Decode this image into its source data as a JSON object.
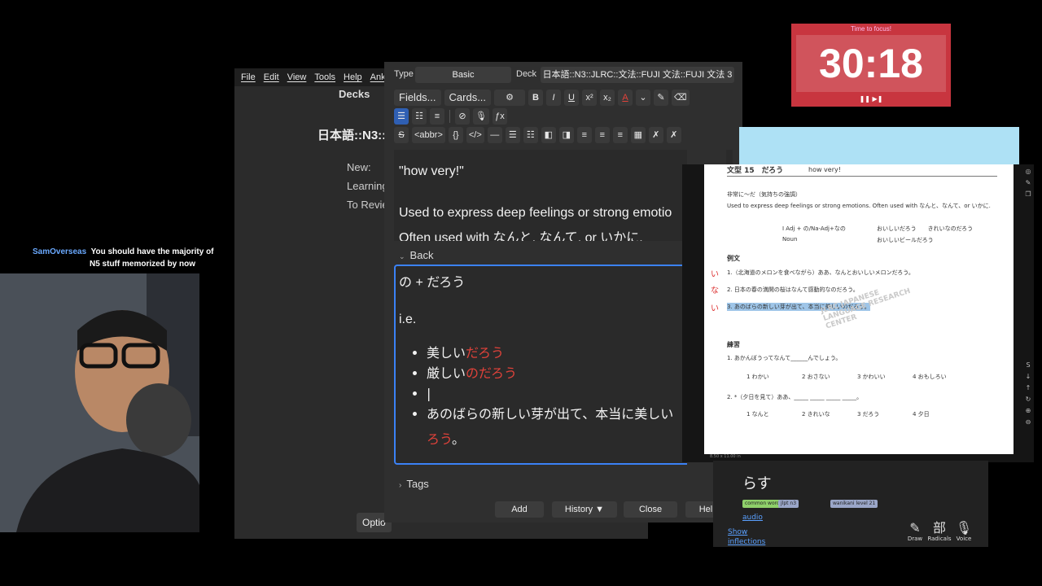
{
  "anki_main": {
    "menu": [
      "File",
      "Edit",
      "View",
      "Tools",
      "Help",
      "Anki"
    ],
    "decks_title": "Decks",
    "deck_name": "日本語::N3::",
    "stats": [
      "New:",
      "Learning",
      "To Revie"
    ],
    "options_label": "Optio"
  },
  "add_dialog": {
    "type_label": "Type",
    "type_value": "Basic",
    "deck_label": "Deck",
    "deck_value": "日本語::N3::JLRC::文法::FUJI 文法::FUJI 文法 3",
    "toolbar1": {
      "fields": "Fields...",
      "cards": "Cards...",
      "gear": "⚙",
      "bold": "B",
      "italic": "I",
      "underline": "U",
      "superscript": "x²",
      "subscript": "x₂",
      "text_color": "A",
      "chevron": "⌄",
      "highlight": "✎",
      "eraser": "⌫"
    },
    "toolbar2": {
      "ul": "☰",
      "ol": "☷",
      "indent": "≡",
      "attach": "⊘",
      "record": "🎙",
      "fx": "ƒx"
    },
    "toolbar3": {
      "strike": "S",
      "abbr": "<abbr>",
      "braces": "{}",
      "code": "</>",
      "hr": "—"
    },
    "front": {
      "line1": "\"how very!\"",
      "line2": "Used to express deep feelings or strong emotio",
      "line3": "Often used with なんと, なんて, or いかに."
    },
    "back_label": "Back",
    "back": {
      "formula": "の + だろう",
      "ie": "i.e.",
      "items": [
        {
          "black": "美しい",
          "red": "だろう"
        },
        {
          "black": "厳しい",
          "red": "のだろう"
        },
        {
          "black": "|",
          "red": ""
        },
        {
          "black": "あのばらの新しい芽が出て、本当に美しい",
          "red": ""
        }
      ],
      "wrap_red": "ろう",
      "wrap_end": "。"
    },
    "tags_label": "Tags",
    "buttons": {
      "add": "Add",
      "history": "History ▼",
      "close": "Close",
      "help": "Help"
    }
  },
  "pdf": {
    "heading": "文型 15　だろう",
    "heading_gloss": "how very!",
    "subtitle": "非常に～だ（気持ちの強調）",
    "desc": "Used to express deep feelings or strong emotions. Often used with なんと、なんて、or いかに.",
    "formula1": "I Adj + の/Na-Adj+なの",
    "formula2": "Noun",
    "ex_right1": "おいしいだろう　　きれいなのだろう",
    "ex_right2": "おいしいビールだろう",
    "reibun": "例文",
    "sentences": [
      "1.（北海道のメロンを食べながら）ああ、なんとおいしいメロンだろう。",
      "2. 日本の春の満開の桜はなんて感動的なのだろう。",
      "3. あのばらの新しい芽が出て、本当に美しいのだろう。"
    ],
    "watermark": "JLRC JAPANESE LANGUAGE RESEARCH CENTER",
    "renshuu": "練習",
    "q1": "1. あかんぼうってなんて______んでしょう。",
    "q1_opts": [
      "1 わかい",
      "2 おさない",
      "3 かわいい",
      "4 おもしろい"
    ],
    "q2": "2. *（夕日を見て）ああ、_____ _____ _____ _____。",
    "q2_opts": [
      "1 なんと",
      "2 きれいな",
      "3 だろう",
      "4 夕日"
    ],
    "page_footer": "8.50 x 11.00 in"
  },
  "dictionary": {
    "word": "らす",
    "tags": [
      "common word",
      "jlpt n3",
      "wanikani level 21"
    ],
    "audio": "audio",
    "show": "Show",
    "inflections": "inflections",
    "tools": [
      {
        "glyph": "✎",
        "label": "Draw"
      },
      {
        "glyph": "部",
        "label": "Radicals"
      },
      {
        "glyph": "🎙",
        "label": "Voice"
      }
    ]
  },
  "timer": {
    "label": "Time to focus!",
    "time": "30:18",
    "controls": "❚❚ ▶❚"
  },
  "chat": {
    "user": "SamOverseas",
    "message_line1": "You should have the majority of",
    "message_line2": "N5 stuff memorized by now"
  },
  "colors": {
    "accent": "#3b82f6",
    "red_text": "#e0423a",
    "timer_bg": "#c8353f"
  }
}
